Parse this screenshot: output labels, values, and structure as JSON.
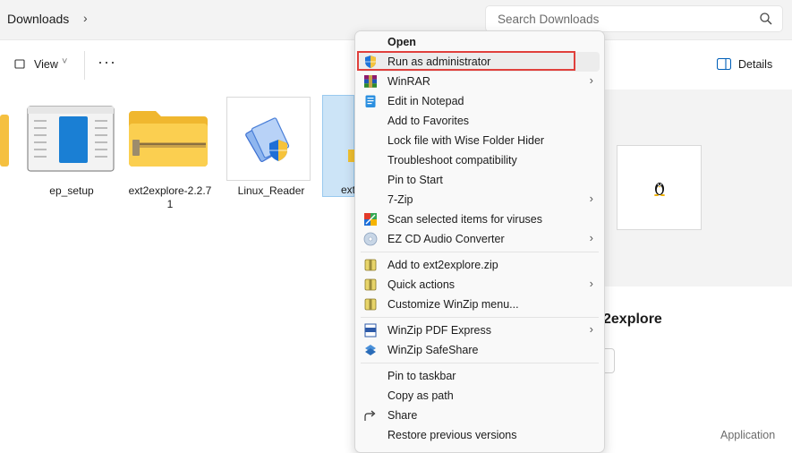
{
  "address": {
    "crumb": "Downloads",
    "chevron": "›"
  },
  "search": {
    "placeholder": "Search Downloads",
    "icon": "search-icon"
  },
  "toolbar": {
    "view_label": "View",
    "view_chevron": "˅",
    "more": "···",
    "details_label": "Details"
  },
  "files": [
    {
      "name": "ep_setup",
      "type": "document"
    },
    {
      "name": "ext2explore-2.2.71",
      "line1": "ext2explore-2.2.7",
      "line2": "1",
      "type": "zip-folder"
    },
    {
      "name": "Linux_Reader",
      "type": "installer"
    },
    {
      "name": "ext",
      "type": "application"
    }
  ],
  "preview": {
    "name": "2explore",
    "type": "Application",
    "icon": "penguin-icon"
  },
  "context_menu": {
    "highlight_color": "#e0403c",
    "items": [
      {
        "label": "Open",
        "bold": true,
        "icon": ""
      },
      {
        "label": "Run as administrator",
        "icon": "shield-icon",
        "highlighted": true
      },
      {
        "label": "WinRAR",
        "icon": "winrar-icon",
        "submenu": true
      },
      {
        "label": "Edit in Notepad",
        "icon": "notepad-icon"
      },
      {
        "label": "Add to Favorites",
        "icon": ""
      },
      {
        "label": "Lock file with Wise Folder Hider",
        "icon": ""
      },
      {
        "label": "Troubleshoot compatibility",
        "icon": ""
      },
      {
        "label": "Pin to Start",
        "icon": ""
      },
      {
        "label": "7-Zip",
        "icon": "",
        "submenu": true
      },
      {
        "label": "Scan selected items for viruses",
        "icon": "antivirus-icon"
      },
      {
        "label": "EZ CD Audio Converter",
        "icon": "cd-icon",
        "submenu": true
      },
      {
        "label": "Add to ext2explore.zip",
        "icon": "winzip-icon"
      },
      {
        "label": "Quick actions",
        "icon": "winzip-icon",
        "submenu": true
      },
      {
        "label": "Customize WinZip menu...",
        "icon": "winzip-icon"
      },
      {
        "label": "WinZip PDF Express",
        "icon": "pdf-icon",
        "submenu": true
      },
      {
        "label": "WinZip SafeShare",
        "icon": "safeshare-icon"
      },
      {
        "label": "Pin to taskbar",
        "icon": ""
      },
      {
        "label": "Copy as path",
        "icon": ""
      },
      {
        "label": "Share",
        "icon": "share-icon"
      },
      {
        "label": "Restore previous versions",
        "icon": ""
      }
    ]
  }
}
